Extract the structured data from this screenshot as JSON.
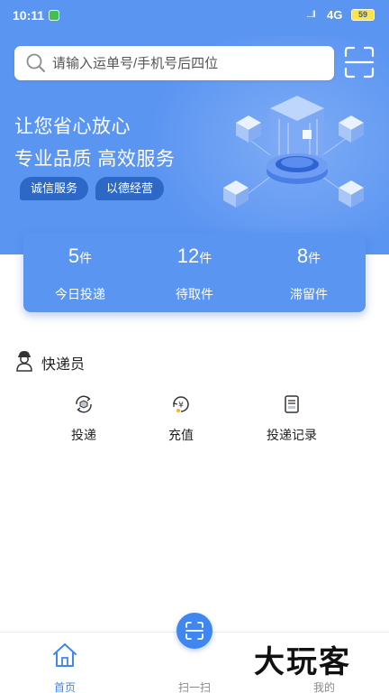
{
  "status_bar": {
    "time": "10:11",
    "signal": "....ll",
    "network": "4G",
    "battery": "59"
  },
  "search": {
    "placeholder": "请输入运单号/手机号后四位"
  },
  "banner": {
    "slogan_line1": "让您省心放心",
    "slogan_line2": "专业品质 高效服务",
    "tags": [
      "诚信服务",
      "以德经营"
    ]
  },
  "stats": [
    {
      "value": "5",
      "unit": "件",
      "label": "今日投递"
    },
    {
      "value": "12",
      "unit": "件",
      "label": "待取件"
    },
    {
      "value": "8",
      "unit": "件",
      "label": "滞留件"
    }
  ],
  "courier_section": {
    "title": "快递员",
    "actions": [
      {
        "label": "投递",
        "icon": "delivery-icon"
      },
      {
        "label": "充值",
        "icon": "recharge-icon"
      },
      {
        "label": "投递记录",
        "icon": "record-icon"
      }
    ]
  },
  "tabbar": {
    "items": [
      {
        "label": "首页",
        "icon": "home-icon",
        "active": true
      },
      {
        "label": "扫一扫",
        "icon": "scan-icon",
        "active": false
      },
      {
        "label": "我的",
        "icon": "profile-icon",
        "active": false
      }
    ]
  },
  "watermark": "大玩客",
  "colors": {
    "primary": "#5b95f2",
    "accent": "#3f86f0",
    "tag_bg": "#2d68c7"
  }
}
